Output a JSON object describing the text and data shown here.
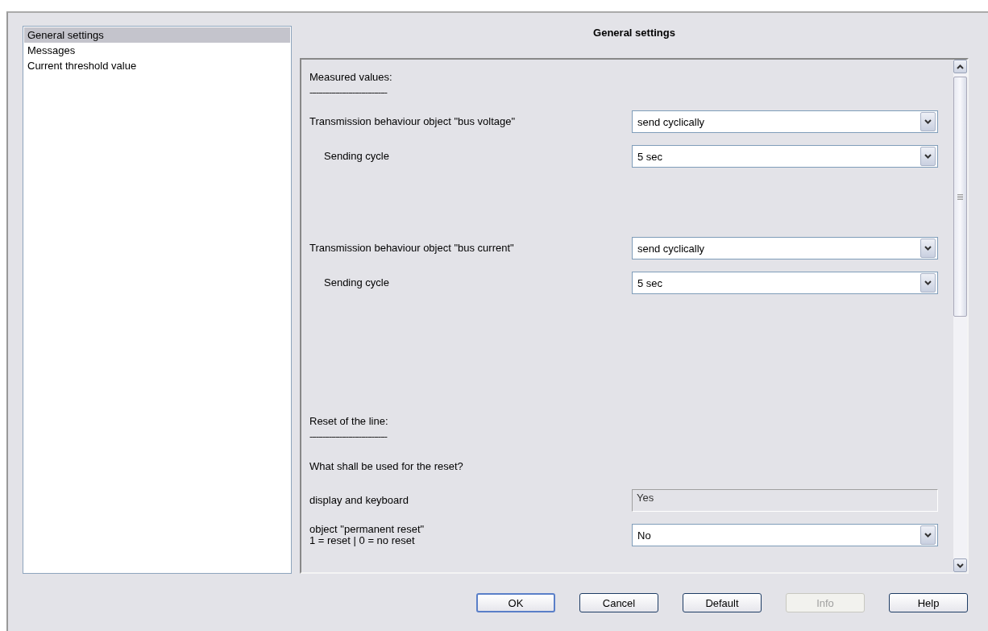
{
  "sidebar": {
    "items": [
      {
        "label": "General settings",
        "selected": true
      },
      {
        "label": "Messages",
        "selected": false
      },
      {
        "label": "Current threshold value",
        "selected": false
      }
    ]
  },
  "panel": {
    "title": "General settings",
    "rows": [
      {
        "kind": "heading",
        "label": "Measured values:",
        "rule": "------------------------------------"
      },
      {
        "kind": "combo",
        "label": "Transmission behaviour object \"bus voltage\"",
        "value": "send cyclically",
        "indented": false
      },
      {
        "kind": "combo",
        "label": "Sending cycle",
        "value": "5 sec",
        "indented": true
      },
      {
        "kind": "combo",
        "label": "Transmission behaviour object \"bus current\"",
        "value": "send cyclically",
        "indented": false
      },
      {
        "kind": "combo",
        "label": "Sending cycle",
        "value": "5 sec",
        "indented": true
      },
      {
        "kind": "heading",
        "label": "Reset of the line:",
        "rule": "------------------------------------"
      },
      {
        "kind": "text",
        "label": "What shall be used for the reset?"
      },
      {
        "kind": "readonly",
        "label": "display and keyboard",
        "value": "Yes"
      },
      {
        "kind": "combo",
        "label": "object \"permanent reset\"\n1 = reset | 0 = no reset",
        "value": "No",
        "indented": false
      }
    ]
  },
  "buttons": [
    {
      "label": "OK",
      "disabled": false,
      "default": true
    },
    {
      "label": "Cancel",
      "disabled": false,
      "default": false
    },
    {
      "label": "Default",
      "disabled": false,
      "default": false
    },
    {
      "label": "Info",
      "disabled": true,
      "default": false
    },
    {
      "label": "Help",
      "disabled": false,
      "default": false
    }
  ]
}
